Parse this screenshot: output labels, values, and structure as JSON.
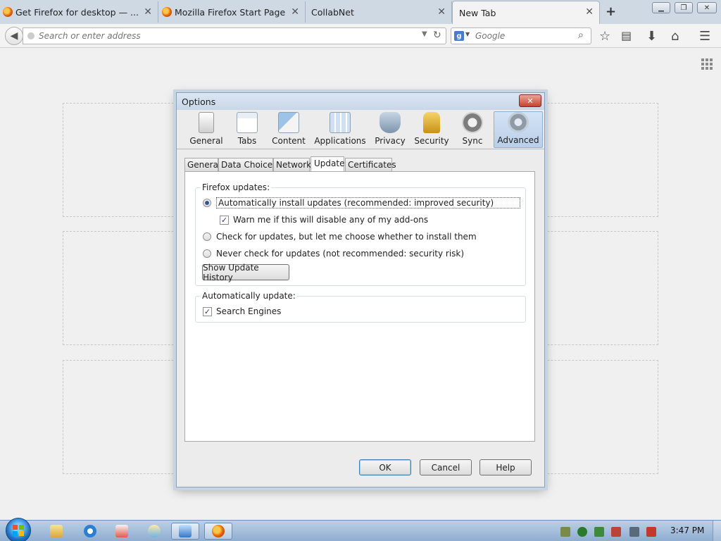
{
  "browser": {
    "tabs": [
      {
        "title": "Get Firefox for desktop — ..."
      },
      {
        "title": "Mozilla Firefox Start Page"
      },
      {
        "title": "CollabNet"
      },
      {
        "title": "New Tab"
      }
    ],
    "urlbar_placeholder": "Search or enter address",
    "search_placeholder": "Google",
    "search_engine_letter": "g"
  },
  "dialog": {
    "title": "Options",
    "panes": [
      "General",
      "Tabs",
      "Content",
      "Applications",
      "Privacy",
      "Security",
      "Sync",
      "Advanced"
    ],
    "selected_pane": "Advanced",
    "subtabs": [
      "General",
      "Data Choices",
      "Network",
      "Update",
      "Certificates"
    ],
    "selected_subtab": "Update",
    "firefox_updates": {
      "caption": "Firefox updates:",
      "auto_install": "Automatically install updates (recommended: improved security)",
      "warn_addons": "Warn me if this will disable any of my add-ons",
      "check_only": "Check for updates, but let me choose whether to install them",
      "never": "Never check for updates (not recommended: security risk)",
      "history_button": "Show Update History"
    },
    "auto_update": {
      "caption": "Automatically update:",
      "search_engines": "Search Engines"
    },
    "buttons": {
      "ok": "OK",
      "cancel": "Cancel",
      "help": "Help"
    }
  },
  "taskbar": {
    "clock": "3:47 PM"
  },
  "colors": {
    "tabstrip": "#cfd9e4",
    "dialog_border": "#8aa0b8",
    "selected_pane": "#b9cfe9",
    "taskbar": "#8fadd0"
  }
}
